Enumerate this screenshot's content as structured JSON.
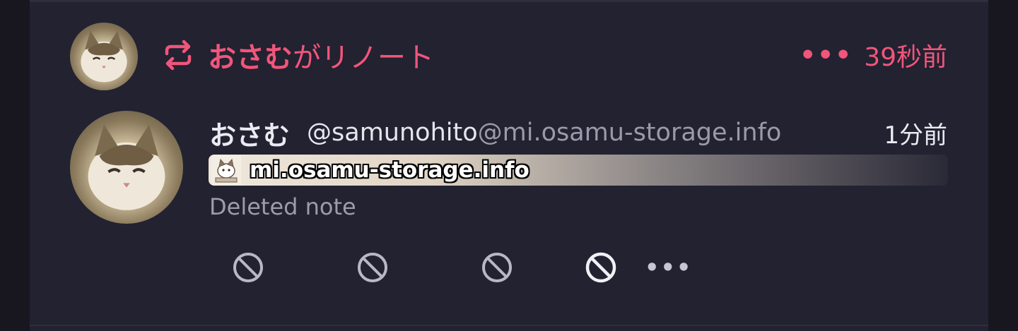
{
  "renote": {
    "user_name": "おさむ",
    "action_text": "がリノート",
    "time": "39秒前",
    "menu_icon": "more-horizontal-icon",
    "icon": "repeat-icon",
    "accent_color": "#f2557a"
  },
  "note": {
    "display_name": "おさむ",
    "username": "@samunohito",
    "host": "@mi.osamu-storage.info",
    "time": "1分前",
    "instance_name": "mi.osamu-storage.info",
    "text": "Deleted note"
  },
  "footer": {
    "actions": [
      "ban-icon",
      "ban-icon",
      "ban-icon",
      "ban-icon"
    ],
    "more_icon": "more-horizontal-icon"
  }
}
